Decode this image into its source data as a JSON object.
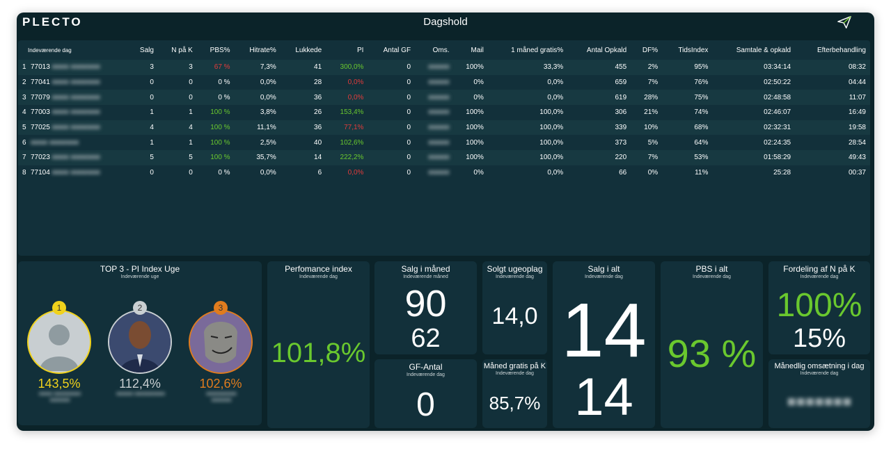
{
  "header": {
    "logo": "PLECTO",
    "title": "Dagshold"
  },
  "table": {
    "columns": [
      "Indeværende dag",
      "Salg",
      "N på K",
      "PBS%",
      "Hitrate%",
      "Lukkede",
      "PI",
      "Antal GF",
      "Oms.",
      "Mail",
      "1 måned gratis%",
      "Antal Opkald",
      "DF%",
      "TidsIndex",
      "Samtale & opkald",
      "Efterbehandling"
    ],
    "rows": [
      {
        "num": "1",
        "id": "77013",
        "salg": "3",
        "npk": "3",
        "pbs": "67 %",
        "hit": "7,3%",
        "luk": "41",
        "pi": "300,0%",
        "gf": "0",
        "mail": "100%",
        "gratis": "33,3%",
        "opk": "455",
        "df": "2%",
        "tid": "95%",
        "samtale": "03:34:14",
        "efter": "08:32"
      },
      {
        "num": "2",
        "id": "77041",
        "salg": "0",
        "npk": "0",
        "pbs": "0 %",
        "hit": "0,0%",
        "luk": "28",
        "pi": "0,0%",
        "gf": "0",
        "mail": "0%",
        "gratis": "0,0%",
        "opk": "659",
        "df": "7%",
        "tid": "76%",
        "samtale": "02:50:22",
        "efter": "04:44"
      },
      {
        "num": "3",
        "id": "77079",
        "salg": "0",
        "npk": "0",
        "pbs": "0 %",
        "hit": "0,0%",
        "luk": "36",
        "pi": "0,0%",
        "gf": "0",
        "mail": "0%",
        "gratis": "0,0%",
        "opk": "619",
        "df": "28%",
        "tid": "75%",
        "samtale": "02:48:58",
        "efter": "11:07"
      },
      {
        "num": "4",
        "id": "77003",
        "salg": "1",
        "npk": "1",
        "pbs": "100 %",
        "hit": "3,8%",
        "luk": "26",
        "pi": "153,4%",
        "gf": "0",
        "mail": "100%",
        "gratis": "100,0%",
        "opk": "306",
        "df": "21%",
        "tid": "74%",
        "samtale": "02:46:07",
        "efter": "16:49"
      },
      {
        "num": "5",
        "id": "77025",
        "salg": "4",
        "npk": "4",
        "pbs": "100 %",
        "hit": "11,1%",
        "luk": "36",
        "pi": "77,1%",
        "gf": "0",
        "mail": "100%",
        "gratis": "100,0%",
        "opk": "339",
        "df": "10%",
        "tid": "68%",
        "samtale": "02:32:31",
        "efter": "19:58"
      },
      {
        "num": "6",
        "id": "",
        "salg": "1",
        "npk": "1",
        "pbs": "100 %",
        "hit": "2,5%",
        "luk": "40",
        "pi": "102,6%",
        "gf": "0",
        "mail": "100%",
        "gratis": "100,0%",
        "opk": "373",
        "df": "5%",
        "tid": "64%",
        "samtale": "02:24:35",
        "efter": "28:54"
      },
      {
        "num": "7",
        "id": "77023",
        "salg": "5",
        "npk": "5",
        "pbs": "100 %",
        "hit": "35,7%",
        "luk": "14",
        "pi": "222,2%",
        "gf": "0",
        "mail": "100%",
        "gratis": "100,0%",
        "opk": "220",
        "df": "7%",
        "tid": "53%",
        "samtale": "01:58:29",
        "efter": "49:43"
      },
      {
        "num": "8",
        "id": "77104",
        "salg": "0",
        "npk": "0",
        "pbs": "0 %",
        "hit": "0,0%",
        "luk": "6",
        "pi": "0,0%",
        "gf": "0",
        "mail": "0%",
        "gratis": "0,0%",
        "opk": "66",
        "df": "0%",
        "tid": "11%",
        "samtale": "25:28",
        "efter": "00:37"
      }
    ]
  },
  "top3": {
    "title": "TOP 3 - PI Index Uge",
    "subtitle": "Indeværende uge",
    "entries": [
      {
        "rank": "1",
        "value": "143,5%",
        "color": "#f0d21c"
      },
      {
        "rank": "2",
        "value": "112,4%",
        "color": "#c9cfd2"
      },
      {
        "rank": "3",
        "value": "102,6%",
        "color": "#e07c1e"
      }
    ]
  },
  "widgets": {
    "perf": {
      "title": "Perfomance index",
      "sub": "Indeværende dag",
      "value": "101,8%"
    },
    "salg_maaned": {
      "title": "Salg i måned",
      "sub": "Indeværende måned",
      "value": "90",
      "value2": "62"
    },
    "gf": {
      "title": "GF-Antal",
      "sub": "Indeværende dag",
      "value": "0"
    },
    "ugeoplag": {
      "title": "Solgt ugeoplag",
      "sub": "Indeværende dag",
      "value": "14,0"
    },
    "gratis": {
      "title": "Måned gratis på K",
      "sub": "Indeværende dag",
      "value": "85,7%"
    },
    "salg_alt": {
      "title": "Salg i alt",
      "sub": "Indeværende dag",
      "value": "14",
      "value2": "14"
    },
    "pbs": {
      "title": "PBS i alt",
      "sub": "Indeværende dag",
      "value": "93 %"
    },
    "fordeling": {
      "title": "Fordeling af N på K",
      "sub": "Indeværende dag",
      "value": "100%",
      "value2": "15%"
    },
    "oms": {
      "title": "Månedlig omsætning i dag",
      "sub": "Indeværende dag"
    }
  },
  "colors": {
    "green": "#6ac82e",
    "red": "#e23b3b",
    "bg": "#0b2329",
    "panel": "#12303a"
  }
}
